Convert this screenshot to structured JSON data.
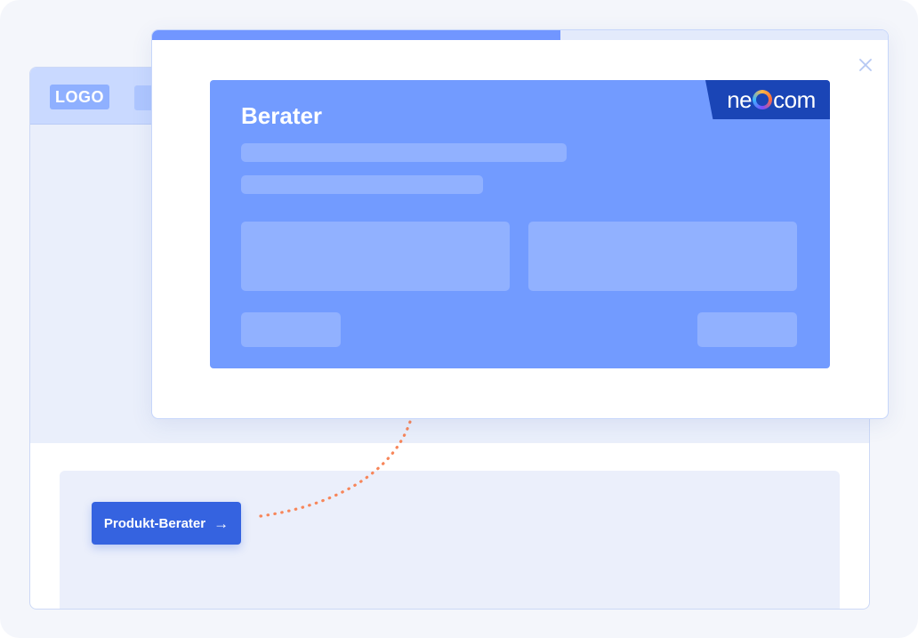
{
  "browser": {
    "logo_text": "LOGO",
    "cta_button": {
      "label": "Produkt-Berater",
      "icon": "arrow-right-icon"
    }
  },
  "modal": {
    "progress_fraction": 0.555,
    "close_icon": "close-icon",
    "widget": {
      "title": "Berater",
      "brand": {
        "prefix": "ne",
        "suffix": "com",
        "ring_icon": "neocom-ring-icon"
      }
    }
  },
  "colors": {
    "page_bg": "#f4f6fb",
    "browser_header": "#c9d9ff",
    "browser_body": "#eaeffb",
    "cta_blue": "#3563e0",
    "widget_blue": "#729bff",
    "brand_dark_blue": "#1a45b6",
    "progress_fill": "#7196ff",
    "connector_orange": "#f7865a"
  }
}
